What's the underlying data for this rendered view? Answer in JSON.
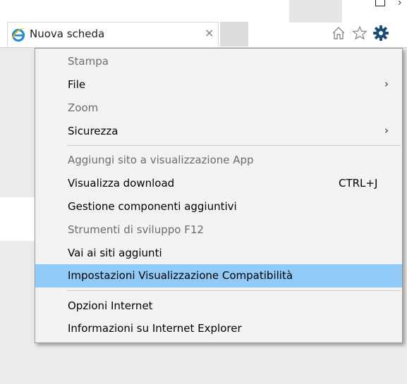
{
  "tab": {
    "title": "Nuova scheda",
    "close": "×"
  },
  "toolbar": {
    "home": "home-icon",
    "favorites": "star-icon",
    "tools": "gear-icon"
  },
  "menu": {
    "items": [
      {
        "label": "Stampa",
        "disabled": true
      },
      {
        "label": "File",
        "submenu": "›"
      },
      {
        "label": "Zoom",
        "disabled": true
      },
      {
        "label": "Sicurezza",
        "submenu": "›"
      },
      {
        "label": "Aggiungi sito a visualizzazione App",
        "disabled": true
      },
      {
        "label": "Visualizza download",
        "shortcut": "CTRL+J"
      },
      {
        "label": "Gestione componenti aggiuntivi"
      },
      {
        "label": "Strumenti di sviluppo F12",
        "disabled": true
      },
      {
        "label": "Vai ai siti aggiunti"
      },
      {
        "label": "Impostazioni Visualizzazione Compatibilità",
        "highlighted": true
      },
      {
        "label": "Opzioni Internet"
      },
      {
        "label": "Informazioni su Internet Explorer"
      }
    ]
  },
  "colors": {
    "highlight": "#91c9f7",
    "menu_bg": "#f2f2f2",
    "gear": "#1b4b74",
    "ie_icon": "#1e88d8"
  }
}
